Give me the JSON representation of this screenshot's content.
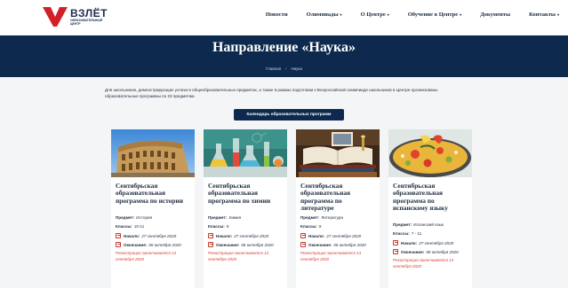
{
  "header": {
    "logo_text": "ВЗЛЁТ",
    "logo_sub": "образовательный центр",
    "brand_color": "#d31f26",
    "nav": [
      {
        "label": "Новости",
        "has_dropdown": false
      },
      {
        "label": "Олимпиады",
        "has_dropdown": true
      },
      {
        "label": "О Центре",
        "has_dropdown": true
      },
      {
        "label": "Обучение в Центре",
        "has_dropdown": true
      },
      {
        "label": "Документы",
        "has_dropdown": false
      },
      {
        "label": "Контакты",
        "has_dropdown": true
      }
    ]
  },
  "hero": {
    "title": "Направление «Наука»",
    "breadcrumb": {
      "home": "Главная",
      "current": "Наука"
    },
    "background": "#0d2a4e"
  },
  "intro_text": "Для школьников, демонстрирующих успехи в общеобразовательных предметах, а также в рамках подготовки к Всероссийской олимпиаде школьников в Центре организованы образовательные программы по 23 предметам.",
  "cta_label": "Календарь образовательных программ",
  "labels": {
    "subject": "Предмет:",
    "grades": "Классы:",
    "start": "Начало:",
    "end": "Окончание:",
    "dropdown_caret": "▾"
  },
  "cards": [
    {
      "image": "colosseum-photo",
      "title": "Сентябрьская образовательная программа по истории",
      "subject": "История",
      "grades": "10-11",
      "start": "27 сентября 2020",
      "end": "06 октября 2020",
      "note": "Регистрация заканчивается 13 сентября 2020"
    },
    {
      "image": "chemistry-flasks-photo",
      "title": "Сентябрьская образовательная программа по химии",
      "subject": "Химия",
      "grades": "9",
      "start": "27 сентября 2020",
      "end": "06 октября 2020",
      "note": "Регистрация заканчивается 13 сентября 2020"
    },
    {
      "image": "books-photo",
      "title": "Сентябрьская образовательная программа по литературе",
      "subject": "Литература",
      "grades": "9",
      "start": "27 сентября 2020",
      "end": "06 октября 2020",
      "note": "Регистрация заканчивается 13 сентября 2020"
    },
    {
      "image": "paella-photo",
      "title": "Сентябрьская образовательная программа по испанскому языку",
      "subject": "Испанский язык",
      "grades": "7 - 11",
      "start": "27 сентября 2020",
      "end": "06 октября 2020",
      "note": "Регистрация заканчивается 13 сентября 2020"
    }
  ],
  "colors": {
    "accent": "#0d2a4e",
    "note": "#d93a2f",
    "page_bg": "#f4f5f7"
  }
}
